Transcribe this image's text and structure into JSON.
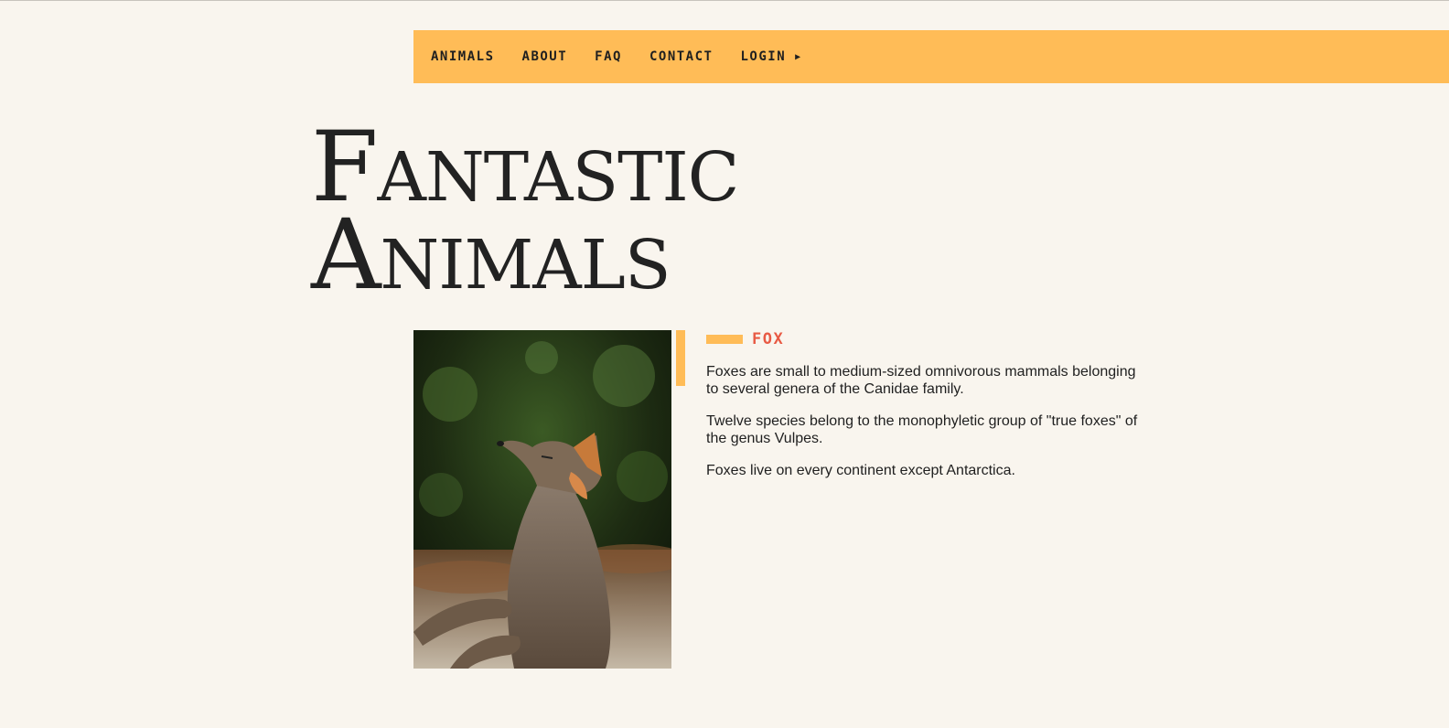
{
  "nav": {
    "items": [
      {
        "label": "ANIMALS"
      },
      {
        "label": "ABOUT"
      },
      {
        "label": "FAQ"
      },
      {
        "label": "CONTACT"
      },
      {
        "label": "LOGIN",
        "icon": "play-arrow-icon"
      }
    ],
    "login_arrow": "▶"
  },
  "page": {
    "title_line1": "Fantastic",
    "title_line2": "Animals"
  },
  "article": {
    "label": "FOX",
    "image_alt": "fox photo",
    "paragraphs": [
      "Foxes are small to medium-sized omnivorous mammals belonging to several genera of the Canidae family.",
      "Twelve species belong to the monophyletic group of \"true foxes\" of the genus Vulpes.",
      "Foxes live on every continent except Antarctica."
    ]
  },
  "colors": {
    "background": "#f9f5ee",
    "accent": "#ffbc57",
    "label": "#e85a44",
    "text": "#222222"
  }
}
